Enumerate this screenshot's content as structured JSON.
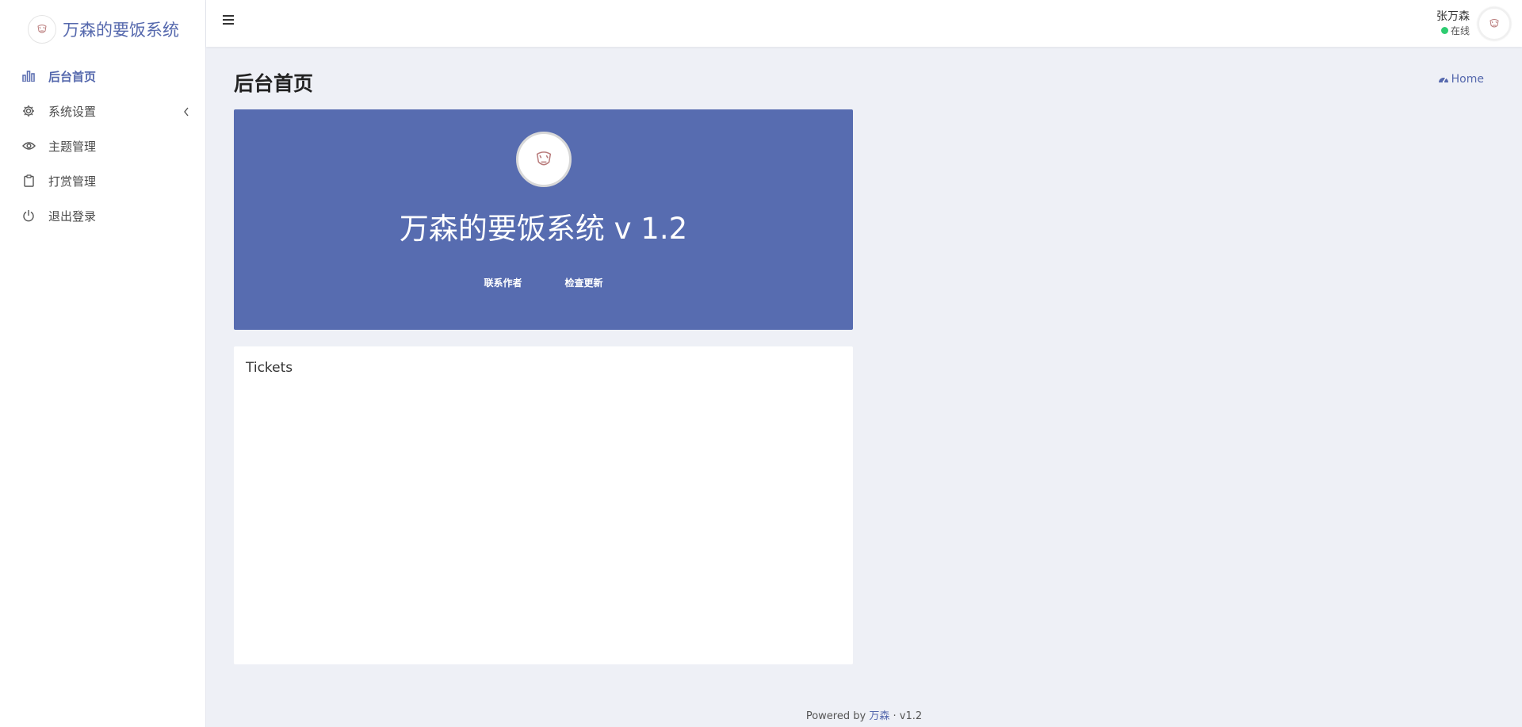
{
  "sidebar": {
    "brand": "万森的要饭系统",
    "items": [
      {
        "label": "后台首页",
        "icon": "bar-chart-icon",
        "active": true
      },
      {
        "label": "系统设置",
        "icon": "gear-icon"
      },
      {
        "label": "主题管理",
        "icon": "eye-icon"
      },
      {
        "label": "打赏管理",
        "icon": "clipboard-icon"
      },
      {
        "label": "退出登录",
        "icon": "power-icon"
      }
    ]
  },
  "topbar": {
    "user_name": "张万森",
    "user_status": "在线"
  },
  "content": {
    "page_title": "后台首页",
    "breadcrumb": "Home"
  },
  "hero": {
    "title": "万森的要饭系统 v 1.2",
    "contact_label": "联系作者",
    "update_label": "检查更新"
  },
  "panel": {
    "title": "Tickets"
  },
  "footer": {
    "prefix": "Powered by",
    "brand": "万森",
    "separator": "·",
    "version": "v1.2"
  },
  "colors": {
    "accent": "#5568ad",
    "hero_bg": "#576cb0",
    "online": "#2ecc71",
    "page_bg": "#eef0f6"
  }
}
